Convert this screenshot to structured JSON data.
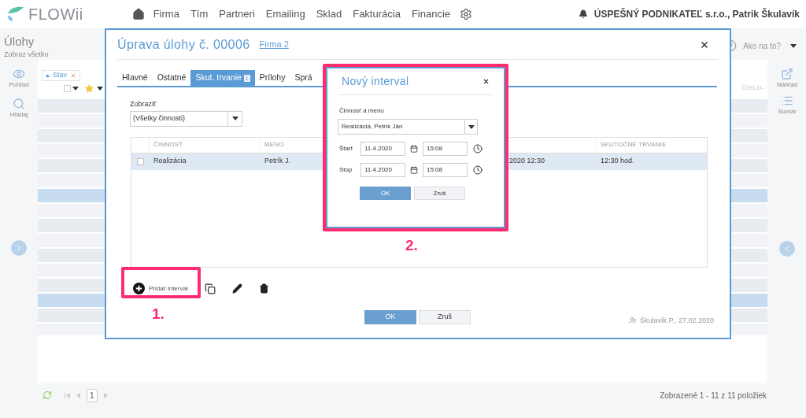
{
  "nav": {
    "logo": "FLOWii",
    "items": [
      "Firma",
      "Tím",
      "Partneri",
      "Emailing",
      "Sklad",
      "Fakturácia",
      "Financie"
    ],
    "account": "ÚSPEŠNÝ PODNIKATEĽ s.r.o., Patrik Škulavík"
  },
  "page": {
    "title": "Úlohy",
    "subtitle": "Zobraz všetko",
    "help": "Ako na to?",
    "filter_chip": "Stav",
    "select_all_checked": false,
    "left_tools": [
      "Pohľad",
      "Hľadaj"
    ],
    "right_tools": [
      "Náhľad",
      "Sumár"
    ],
    "column_header": "ČÍSLO-",
    "pager": {
      "page": "1",
      "summary": "Zobrazené 1 - 11 z 11 položiek"
    }
  },
  "dialog": {
    "title": "Úprava úlohy č. 00006",
    "link": "Firma 2",
    "tabs": [
      {
        "label": "Hlavné",
        "selected": false
      },
      {
        "label": "Ostatné",
        "selected": false
      },
      {
        "label": "Skut. trvanie",
        "badge": "1",
        "selected": true
      },
      {
        "label": "Prílohy",
        "selected": false
      },
      {
        "label": "Sprá",
        "selected": false
      }
    ],
    "filter_label": "Zobraziť",
    "filter_value": "(Všetky činnosti)",
    "table": {
      "columns": [
        "",
        "ČINNOSŤ",
        "MENO",
        "",
        "SKUTOČNÉ TRVANIE"
      ],
      "rows": [
        {
          "cells": [
            "",
            "Realizácia",
            "Petrík J.",
            "2020 12:30",
            "12:30 hod."
          ],
          "checked": false,
          "selected": true
        }
      ]
    },
    "add_button": "Pridať interval",
    "ok": "OK",
    "cancel": "Zruš",
    "author": "Škulavík P., 27.02.2020"
  },
  "sub_dialog": {
    "title": "Nový interval",
    "field_label": "Činnosť a meno",
    "field_value": "Realizácia, Petrík Ján",
    "rows": [
      {
        "label": "Štart",
        "date": "11.4.2020",
        "time": "15:08"
      },
      {
        "label": "Stop",
        "date": "11.4.2020",
        "time": "15:08"
      }
    ],
    "ok": "OK",
    "cancel": "Zruš"
  },
  "annotations": [
    "1.",
    "2."
  ]
}
